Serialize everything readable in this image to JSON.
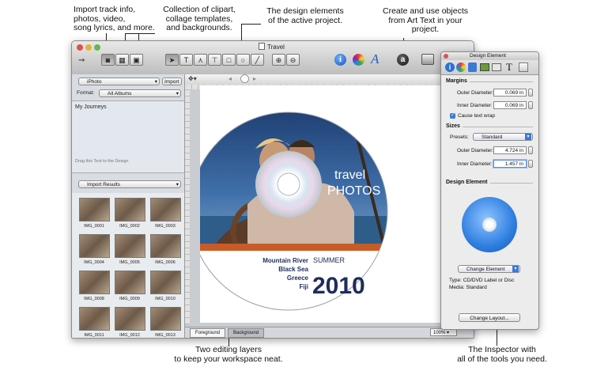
{
  "callouts": {
    "import": [
      "Import track info,",
      "photos, video,",
      "song lyrics, and more."
    ],
    "collection": [
      "Collection of clipart,",
      "collage templates,",
      "and backgrounds."
    ],
    "design": [
      "The design elements",
      "of the active project."
    ],
    "arttext": [
      "Create and use objects",
      "from Art Text in your",
      "project."
    ],
    "layers": [
      "Two editing layers",
      "to keep your workspace neat."
    ],
    "inspector": [
      "The Inspector with",
      "all of the tools you need."
    ]
  },
  "window": {
    "title": "Travel"
  },
  "left_pane": {
    "source_popup": "iPhoto",
    "import_button": "Import",
    "format_label": "Format:",
    "format_popup": "All Albums",
    "album": "My Journeys",
    "drag_hint": "Drag this Text to the Design",
    "results_popup": "Import Results",
    "thumbnails": [
      "IMG_0001",
      "IMG_0002",
      "IMG_0003",
      "IMG_0004",
      "IMG_0005",
      "IMG_0006",
      "IMG_0008",
      "IMG_0009",
      "IMG_0010",
      "IMG_0011",
      "IMG_0012",
      "IMG_0013"
    ]
  },
  "disc": {
    "title_line1": "travel",
    "title_line2": "PHOTOS",
    "places": [
      "Mountain River",
      "Black Sea",
      "Greece",
      "Fiji"
    ],
    "season": "SUMMER",
    "year": "2010"
  },
  "canvas": {
    "tab_foreground": "Foreground",
    "tab_background": "Background",
    "zoom": "100%"
  },
  "inspector": {
    "title": "Design Element",
    "margins_header": "Margins",
    "outer_label": "Outer Diameter:",
    "outer_value": "0.069 in",
    "inner_label": "Inner Diameter:",
    "inner_value": "0.069 in",
    "cause_wrap": "Cause text wrap",
    "sizes_header": "Sizes",
    "presets_label": "Presets:",
    "presets_value": "Standard",
    "size_outer_label": "Outer Diameter:",
    "size_outer_value": "4.724 in",
    "size_inner_label": "Inner Diameter:",
    "size_inner_value": "1.457 in",
    "element_header": "Design Element",
    "change_element": "Change Element",
    "type_line": "Type: CD/DVD Label or Disc",
    "media_line": "Media: Standard",
    "change_layout": "Change Layout..."
  },
  "colors": {
    "disc_band": "#c85b26",
    "disc_year": "#1f2d5c",
    "disc_title": "#ffffff",
    "cd_blue": "#2f7fe0"
  }
}
